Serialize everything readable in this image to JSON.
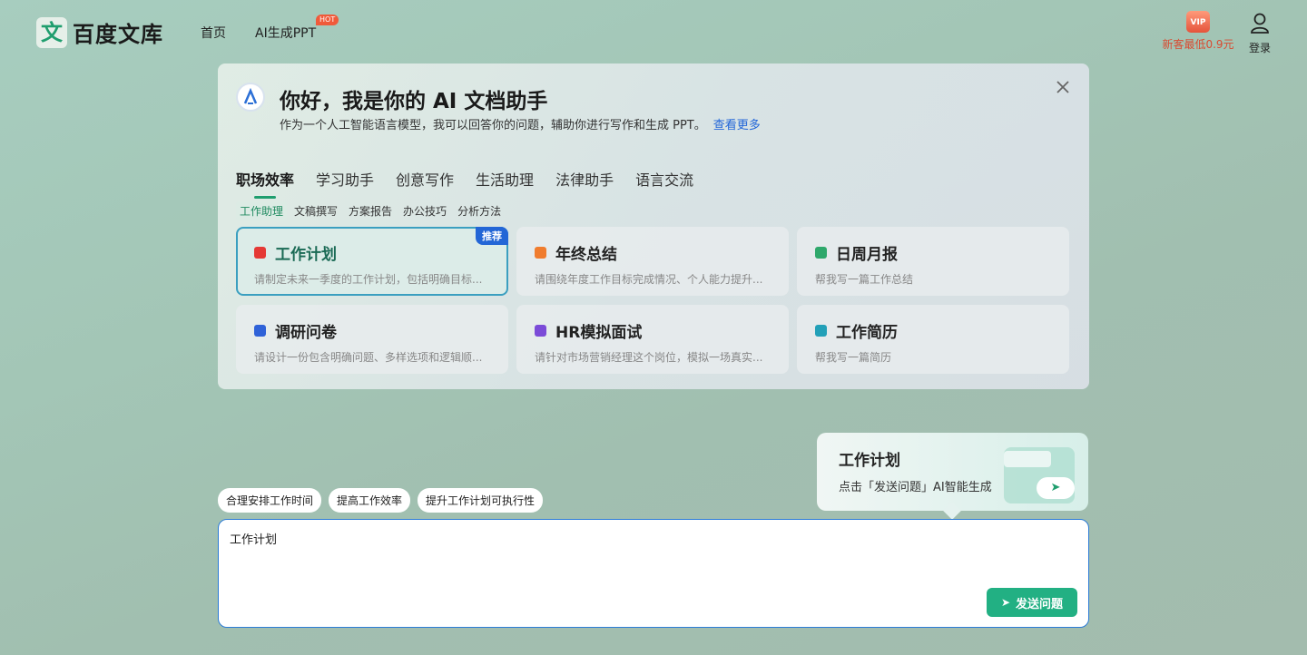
{
  "header": {
    "logo_mark": "文",
    "logo_text": "百度文库",
    "nav": [
      {
        "label": "首页"
      },
      {
        "label": "AI生成PPT",
        "badge": "HOT"
      }
    ],
    "vip_icon": "VIP",
    "vip_text": "新客最低0.9元",
    "login": "登录"
  },
  "assistant": {
    "title": "你好，我是你的 AI 文档助手",
    "subtitle": "作为一个人工智能语言模型，我可以回答你的问题，辅助你进行写作和生成 PPT。",
    "more_link": "查看更多",
    "tabs": [
      "职场效率",
      "学习助手",
      "创意写作",
      "生活助理",
      "法律助手",
      "语言交流"
    ],
    "subtabs": [
      "工作助理",
      "文稿撰写",
      "方案报告",
      "办公技巧",
      "分析方法"
    ],
    "cards": [
      {
        "title": "工作计划",
        "desc": "请制定未来一季度的工作计划，包括明确目标...",
        "badge": "推荐",
        "icon": "pdf-icon",
        "color": "#e53935"
      },
      {
        "title": "年终总结",
        "desc": "请围绕年度工作目标完成情况、个人能力提升...",
        "icon": "chart-icon",
        "color": "#f07c2e"
      },
      {
        "title": "日周月报",
        "desc": "帮我写一篇工作总结",
        "icon": "report-icon",
        "color": "#2ea86b"
      },
      {
        "title": "调研问卷",
        "desc": "请设计一份包含明确问题、多样选项和逻辑顺...",
        "icon": "survey-icon",
        "color": "#2f62d8"
      },
      {
        "title": "HR模拟面试",
        "desc": "请针对市场营销经理这个岗位，模拟一场真实...",
        "icon": "interview-icon",
        "color": "#7b4bd8"
      },
      {
        "title": "工作简历",
        "desc": "帮我写一篇简历",
        "icon": "resume-icon",
        "color": "#22a0b8"
      }
    ]
  },
  "tip": {
    "title": "工作计划",
    "subtitle": "点击「发送问题」AI智能生成"
  },
  "suggestions": [
    "合理安排工作时间",
    "提高工作效率",
    "提升工作计划可执行性"
  ],
  "input": {
    "value": "工作计划"
  },
  "send_button": "发送问题"
}
